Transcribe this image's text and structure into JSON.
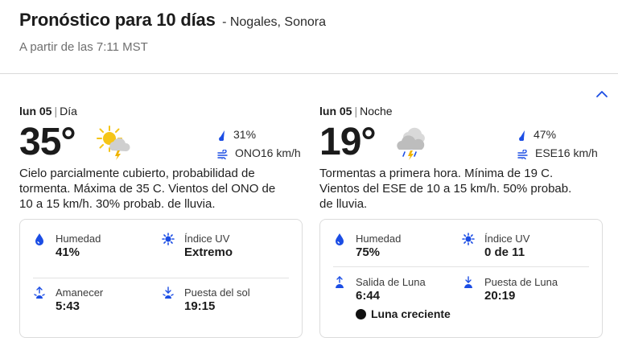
{
  "header": {
    "title": "Pronóstico para 10 días",
    "location": "- Nogales, Sonora",
    "as_of": "A partir de las 7:11 MST"
  },
  "day": {
    "date": "lun 05",
    "separator": "|",
    "period": "Día",
    "temp": "35°",
    "icon": "partly-cloudy-thunderstorm-icon",
    "precip": "31%",
    "wind": "ONO16 km/h",
    "narrative": "Cielo parcialmente cubierto, probabilidad de tormenta. Máxima de 35 C. Vientos del ONO de 10 a 15 km/h. 30% probab. de lluvia.",
    "details": {
      "humidity_label": "Humedad",
      "humidity_value": "41%",
      "uv_label": "Índice UV",
      "uv_value": "Extremo",
      "sunrise_label": "Amanecer",
      "sunrise_value": "5:43",
      "sunset_label": "Puesta del sol",
      "sunset_value": "19:15"
    }
  },
  "night": {
    "date": "lun 05",
    "separator": "|",
    "period": "Noche",
    "temp": "19°",
    "icon": "cloudy-thunderstorm-icon",
    "precip": "47%",
    "wind": "ESE16 km/h",
    "narrative": "Tormentas a primera hora. Mínima de 19 C. Vientos del ESE de 10 a 15 km/h. 50% probab. de lluvia.",
    "details": {
      "humidity_label": "Humedad",
      "humidity_value": "75%",
      "uv_label": "Índice UV",
      "uv_value": "0 de 11",
      "moonrise_label": "Salida de Luna",
      "moonrise_value": "6:44",
      "moonset_label": "Puesta de Luna",
      "moonset_value": "20:19",
      "moon_phase": "Luna creciente"
    }
  },
  "colors": {
    "accent": "#1b4de4",
    "sun": "#f5c518",
    "cloud": "#c9c9c9",
    "bolt": "#f0b400"
  }
}
